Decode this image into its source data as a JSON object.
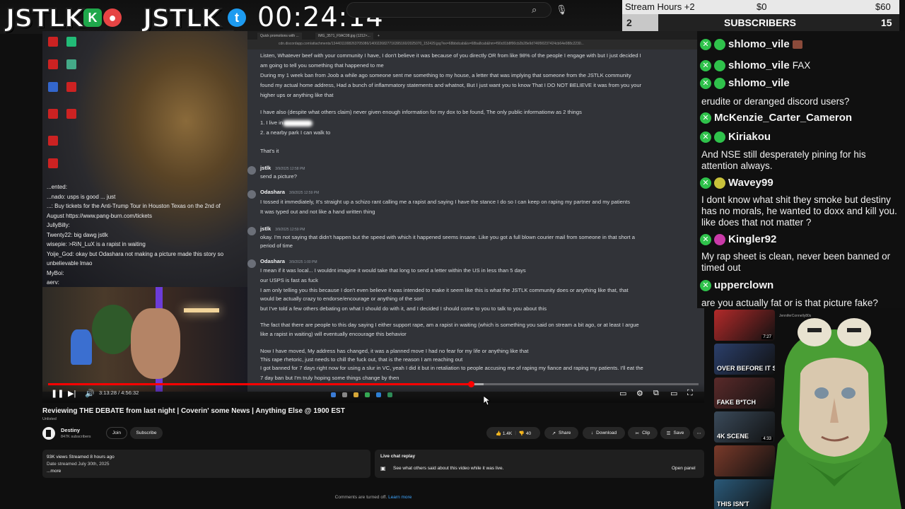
{
  "brand": {
    "logo_left": "JSTLK",
    "logo_right": "JSTLK_",
    "timer": "00:24:14"
  },
  "goal": {
    "label": "Stream Hours +2",
    "min": "$0",
    "max": "$60",
    "current": "2",
    "title": "SUBSCRIBERS",
    "target": "15",
    "progress": 0.13
  },
  "player": {
    "overlay_chat": [
      "...ented: ",
      "...nado: usps is good ... just",
      "...: Buy tickets for the Anti-Trump Tour in Houston Texas on the 2nd of",
      "August https://www.pang-burn.com/tickets",
      "JullyBilly: ",
      "Twenty22: big dawg jstlk",
      "wisepie: >RiN_LuX is a rapist in waiting",
      "Yoije_God: okay but Odashara not making a picture made this story so",
      "unbelievable lmao",
      "MyBoi: ",
      "aerv: "
    ],
    "browser_tabs": [
      "Quick promotions with ...",
      "IMG_3571_F9AC08.jpg (1212×...",
      "+"
    ],
    "address": "cdn.discordapp.com/attachments/1344011008263705086/1400226827716395160/2025070_152429.jpg?ex=68bbdcab&is=68ba8cab&hm=f90c81b8f90cb2b28e9d746f90237424cb64e088c2230...",
    "messages": [
      {
        "text": "Listen, Whatever beef with your community I have, I don't believe it was because of you directly OR from like 98% of the people I engage with but I just decided I"
      },
      {
        "text": "am going to tell you something that happened to me"
      },
      {
        "text": "During my 1 week ban from Joob a while ago someone sent me something to my house, a letter that was implying that someone from the JSTLK community"
      },
      {
        "text": "found my actual home address, Had a bunch of inflammatory statements and whatnot, But I just want you to know That I DO NOT BELIEVE it was from you your"
      },
      {
        "text": "higher ups or anything like that"
      },
      {
        "text": "I have also (despite what others claim) never given enough information for my dox to be found, The only public informationw as 2 things"
      },
      {
        "text": "1. I live in"
      },
      {
        "text": "2. a nearby park I can walk to"
      },
      {
        "text": "That's it"
      },
      {
        "author": "jstlk",
        "stamp": "3/9/2025 12:58 PM"
      },
      {
        "text": "send a picture?"
      },
      {
        "author": "Odashara",
        "stamp": "3/9/2025 12:59 PM"
      },
      {
        "text": "I tossed it immediately, It's straight up a schizo rant calling me a rapist and saying I have the stance I do so I can keep on raping my partner and my patients"
      },
      {
        "text": "It was typed out and not like a hand written thing"
      },
      {
        "author": "jstlk",
        "stamp": "3/9/2025 12:59 PM"
      },
      {
        "text": "okay. I'm not saying that didn't happen but the speed with which it happened seems insane. Like you got a full blown courier mail from someone in that short a"
      },
      {
        "text": "period of time"
      },
      {
        "author": "Odashara",
        "stamp": "3/9/2025 1:00 PM"
      },
      {
        "text": "I mean if it was local... I wouldnt imagine it would take that long to send a letter within the US in less than 5 days"
      },
      {
        "text": "our USPS is fast as fuck"
      },
      {
        "text": "I am only telling you this because I don't even believe it was intended to make it seem like this is what the JSTLK community does or anything like that, that"
      },
      {
        "text": "would be actually crazy to endorse/encourage or anything of the sort"
      },
      {
        "text": "but I've told a few others debating on what I should do with it, and I decided I should come to you to talk to you about this"
      },
      {
        "text": "The fact that there are people to this day saying I either support rape, am a rapist in waiting (which is something you said on stream a bit ago, or at least I argue"
      },
      {
        "text": "like a rapist in waiting) will eventually encourage this behavior"
      },
      {
        "text": "Now I have moved, My address has changed, it was a planned move I had no fear for my life or anything like that"
      },
      {
        "text": "This rape rhetoric, just needs to chill the fuck out, that is the reason I am reaching out"
      },
      {
        "text": "I got banned for 7 days right now for using a slur in VC, yeah I did it but in retaliation to people accusing me of raping my fiance and raping my patients. I'll eat the"
      },
      {
        "text": "7 day ban but I'm truly hoping some things change by then"
      }
    ],
    "time": "3:13:28 / 4:56:32",
    "played_fraction": 0.65
  },
  "video": {
    "title": "Reviewing THE DEBATE from last night | Coverin' some News | Anything Else @ 1900 EST",
    "visibility": "Unlisted",
    "channel": "Destiny",
    "subs": "847K subscribers",
    "join": "Join",
    "subscribe": "Subscribe",
    "likes": "1.4K",
    "dislikes": "40",
    "share": "Share",
    "download": "Download",
    "clip": "Clip",
    "save": "Save",
    "more": "⋯",
    "views": "93K views  Streamed 8 hours ago",
    "date": "Date streamed July 30th, 2025",
    "desc_more": "...more",
    "livechat_title": "Live chat replay",
    "livechat_text": "See what others said about this video while it was live.",
    "open_panel": "Open panel",
    "comments_off": "Comments are turned off.",
    "learn_more": "Learn more"
  },
  "chat": [
    {
      "user": "shlomo_vile",
      "bubble": "#2fc24b",
      "extra": ""
    },
    {
      "user": "shlomo_vile",
      "bubble": "#2fc24b",
      "extra": "FAX"
    },
    {
      "user": "shlomo_vile",
      "bubble": "#2fc24b",
      "text": "erudite or deranged discord users?"
    },
    {
      "user": "McKenzie_Carter_Cameron",
      "text": ""
    },
    {
      "user": "Kiriakou",
      "bubble": "#2fc24b",
      "text": "And NSE still desperately pining for his attention always."
    },
    {
      "user": "Wavey99",
      "bubble": "#c9c23a",
      "text": "I dont know what shit they smoke but destiny has no morals, he wanted to doxx and kill you. like does that not matter ?"
    },
    {
      "user": "Kingler92",
      "bubble": "#c93aa8",
      "text": "My rap sheet is clean, never been banned or timed out"
    },
    {
      "user": "upperclown",
      "text": "are you actually fat or is that picture fake?"
    }
  ],
  "suggested": [
    {
      "title": "",
      "duration": "7:27",
      "meta": "JenniferConnelly80s"
    },
    {
      "title": "OVER BEFORE IT STARTED",
      "duration": "",
      "meta": ""
    },
    {
      "title": "FAKE B*TCH",
      "duration": "",
      "meta": ""
    },
    {
      "title": "4K SCENE",
      "duration": "4:33",
      "meta": ""
    },
    {
      "title": "",
      "duration": "",
      "meta": ""
    },
    {
      "title": "THIS ISN'T",
      "duration": "",
      "meta": ""
    }
  ]
}
